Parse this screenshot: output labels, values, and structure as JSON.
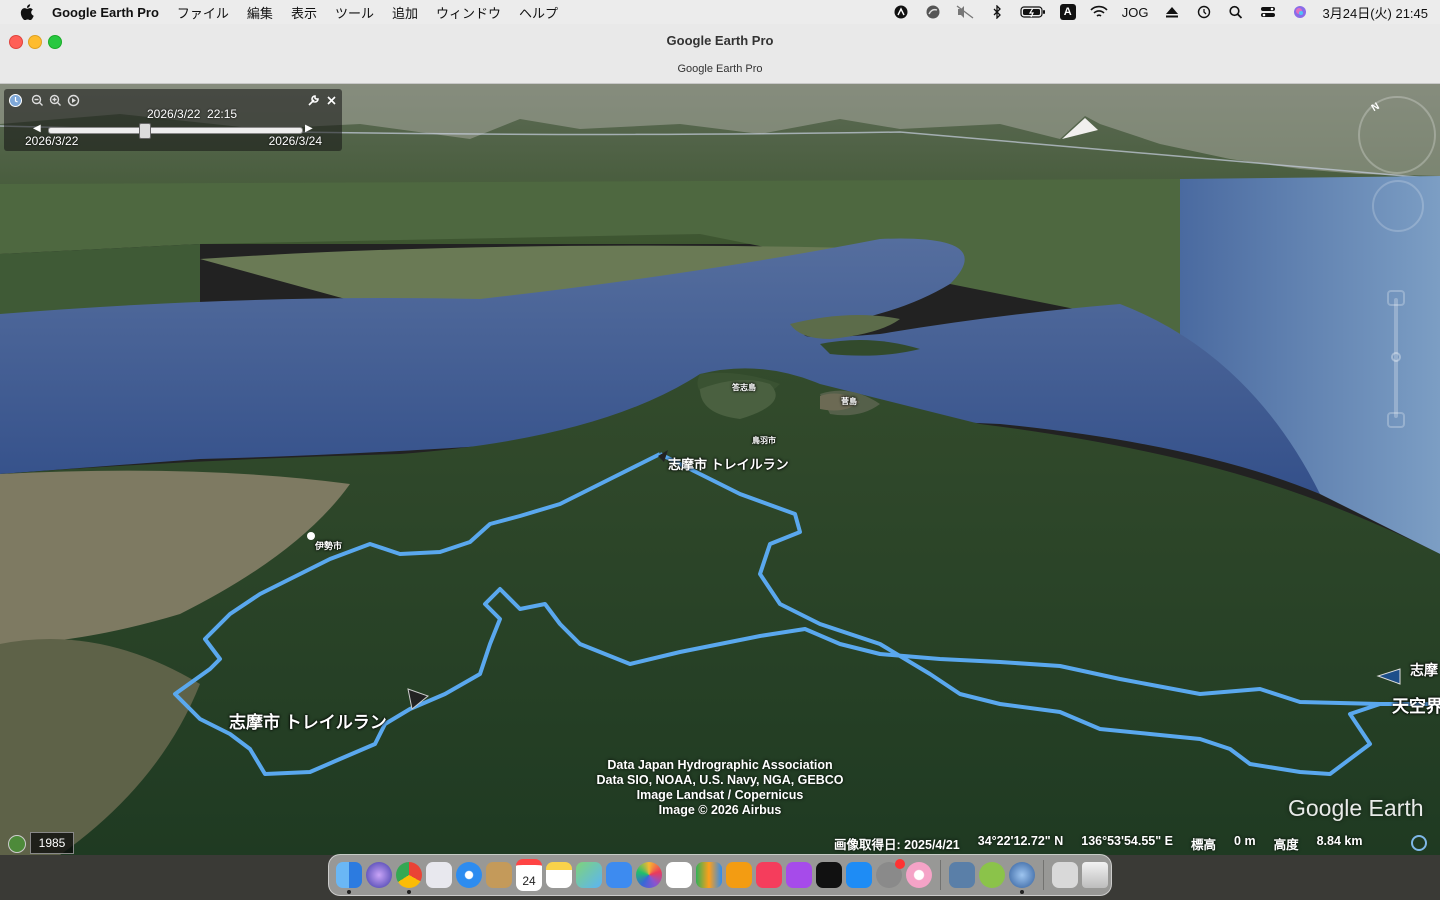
{
  "menubar": {
    "app_name": "Google Earth Pro",
    "items": [
      "ファイル",
      "編集",
      "表示",
      "ツール",
      "追加",
      "ウィンドウ",
      "ヘルプ"
    ],
    "status": {
      "input_mode": "A",
      "jog_label": "JOG",
      "clock": "3月24日(火) 21:45"
    }
  },
  "window": {
    "title": "Google Earth Pro",
    "tab_title": "Google Earth Pro"
  },
  "time_slider": {
    "current": "2026/3/22  22:15",
    "start": "2026/3/22",
    "end": "2026/3/24",
    "position_fraction": 0.37
  },
  "map_labels": {
    "trail_main": "志摩市 トレイルラン",
    "trail_top": "志摩市 トレイルラン",
    "ise_city": "伊勢市",
    "toshi_island": "答志島",
    "suga_island": "菅島",
    "toba_city": "鳥羽市",
    "shima_right": "志摩",
    "tenku": "天空界"
  },
  "attribution": [
    "Data Japan Hydrographic Association",
    "Data SIO, NOAA, U.S. Navy, NGA, GEBCO",
    "Image Landsat / Copernicus",
    "Image © 2026 Airbus"
  ],
  "logo": "Google Earth",
  "historical": {
    "year": "1985"
  },
  "status_bar": {
    "image_date": "画像取得日: 2025/4/21",
    "latitude": "34°22'12.72\" N",
    "longitude": "136°53'54.55\" E",
    "elevation_label": "標高",
    "elevation": "0 m",
    "altitude_label": "高度",
    "altitude": "8.84 km"
  },
  "dock": {
    "apps": [
      "finder-icon",
      "siri-icon",
      "chrome-icon",
      "launchpad-icon",
      "safari-icon",
      "contacts-icon",
      "calendar-icon",
      "notes-icon",
      "maps-icon",
      "mail-icon",
      "photos-icon",
      "freeform-icon",
      "numbers-icon",
      "books-icon",
      "music-icon",
      "podcasts-icon",
      "apple-tv-icon",
      "app-store-icon",
      "system-settings-icon",
      "donut-app-icon",
      "preview-icon",
      "android-file-icon",
      "google-earth-pro-icon",
      "screenshot-icon",
      "trash-icon"
    ],
    "calendar_day": "24",
    "colors": {
      "route": "#5AA8EE",
      "water": "#3E5C95",
      "forest": "#27422A"
    }
  }
}
